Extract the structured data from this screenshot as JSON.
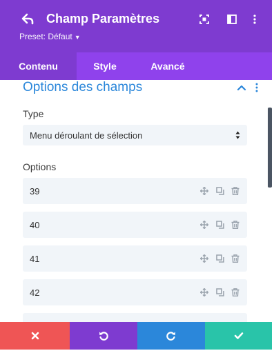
{
  "header": {
    "title": "Champ Paramètres",
    "preset_label": "Preset: Défaut",
    "icons": [
      "back-arrow-icon",
      "focus-icon",
      "split-view-icon",
      "more-vertical-icon"
    ],
    "background_color": "#7e3bd0"
  },
  "tabs": [
    {
      "label": "Contenu",
      "active": true
    },
    {
      "label": "Style",
      "active": false
    },
    {
      "label": "Avancé",
      "active": false
    }
  ],
  "section": {
    "title": "Options des champs",
    "expanded": true,
    "title_color": "#2b87da"
  },
  "type_field": {
    "label": "Type",
    "value": "Menu déroulant de sélection"
  },
  "options_field": {
    "label": "Options",
    "items": [
      {
        "value": "39"
      },
      {
        "value": "40"
      },
      {
        "value": "41"
      },
      {
        "value": "42"
      }
    ],
    "row_icons": [
      "move-icon",
      "duplicate-icon",
      "trash-icon"
    ]
  },
  "footer": {
    "buttons": [
      {
        "name": "cancel",
        "icon": "close-icon",
        "color": "#ef5555"
      },
      {
        "name": "undo",
        "icon": "undo-icon",
        "color": "#7e3bd0"
      },
      {
        "name": "redo",
        "icon": "redo-icon",
        "color": "#2b87da"
      },
      {
        "name": "save",
        "icon": "check-icon",
        "color": "#29c4a9"
      }
    ]
  }
}
